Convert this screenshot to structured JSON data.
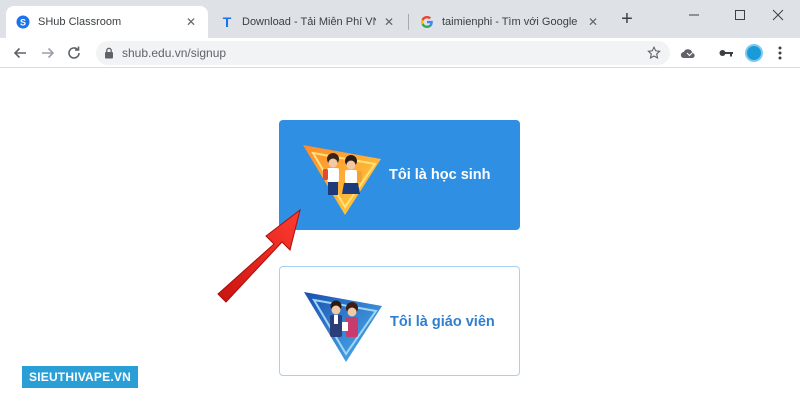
{
  "browser": {
    "tabs": [
      {
        "title": "SHub Classroom",
        "active": true
      },
      {
        "title": "Download - Tải Miễn Phí VN - P",
        "active": false
      },
      {
        "title": "taimienphi - Tìm với Google",
        "active": false
      }
    ],
    "new_tab_label": "+",
    "address": "shub.edu.vn/signup"
  },
  "signup": {
    "student_label": "Tôi là học sinh",
    "teacher_label": "Tôi là giáo viên"
  },
  "watermark": "SIEUTHIVAPE.VN",
  "colors": {
    "student_card": "#2f8fe3",
    "teacher_border": "#a9d1f2",
    "teacher_text": "#2f7fd0",
    "arrow": "#e8231f",
    "watermark_bg": "#2a9fd6"
  },
  "icons": [
    "shub-favicon",
    "t-favicon",
    "google-favicon",
    "close-icon",
    "minimize-icon",
    "maximize-icon",
    "window-close-icon",
    "back-icon",
    "forward-icon",
    "reload-icon",
    "lock-icon",
    "star-icon",
    "extension-icon",
    "key-icon",
    "avatar",
    "more-icon"
  ]
}
